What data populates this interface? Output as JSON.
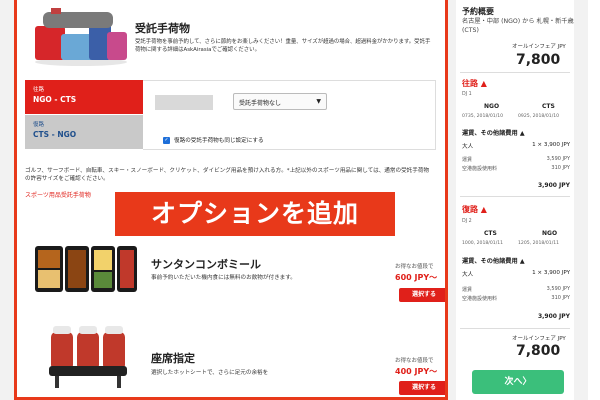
{
  "baggage": {
    "title": "受託手荷物",
    "desc": "受託手荷物を事前予約して、さらに節約をお楽しみください！重量、サイズが超過の場合、超過料金がかかります。受託手荷物に関する詳細はAskAirasiaでご確認ください。",
    "leg1_label": "往路",
    "leg1_route": "NGO - CTS",
    "leg2_label": "復路",
    "leg2_route": "CTS - NGO",
    "select_value": "受託手荷物なし",
    "same_return_label": "復路の受託手荷物も同じ設定にする"
  },
  "sports": {
    "desc": "ゴルフ、サーフボード、自転車、スキー・スノーボード、クリケット、ダイビング用品を預け入れる方。*上記以外のスポーツ用品に関しては、通常の受託手荷物の許容サイズをご確認ください。",
    "link": "スポーツ用品受託手荷物"
  },
  "banner": "オプションを追加",
  "meal": {
    "title": "サンタンコンボミール",
    "desc": "事前予約いただいた機内食には無料のお飲物が付きます。",
    "price_label": "お得なお値段で",
    "price": "600 JPY〜",
    "button": "選択する"
  },
  "seat": {
    "title": "座席指定",
    "desc": "選択したホットシートで、さらに足元の余裕を",
    "price_label": "お得なお値段で",
    "price": "400 JPY〜",
    "button": "選択する"
  },
  "summary": {
    "title": "予約概要",
    "route": "名古屋・中部 (NGO) から 札幌・新千歳 (CTS)",
    "fare_label": "オールインフェア JPY",
    "total": "7,800",
    "outbound": {
      "head": "往路",
      "flight": "DJ 1",
      "from": "NGO",
      "to": "CTS",
      "dep": "0735, 2018/01/10",
      "arr": "0925, 2018/01/10",
      "fare_head": "運賃、その他諸費用",
      "pax_label": "大人",
      "pax_value": "1 × 3,900 JPY",
      "fare_label": "運賃",
      "fare_value": "3,590 JPY",
      "fee_label": "空港施設使用料",
      "fee_value": "310 JPY",
      "subtotal": "3,900 JPY"
    },
    "inbound": {
      "head": "復路",
      "flight": "DJ 2",
      "from": "CTS",
      "to": "NGO",
      "dep": "1000, 2018/01/11",
      "arr": "1205, 2018/01/11",
      "fare_head": "運賃、その他諸費用",
      "pax_label": "大人",
      "pax_value": "1 × 3,900 JPY",
      "fare_label": "運賃",
      "fare_value": "3,590 JPY",
      "fee_label": "空港施設使用料",
      "fee_value": "310 JPY",
      "subtotal": "3,900 JPY"
    },
    "next_button": "次へ〉"
  },
  "colors": {
    "accent": "#e0201a",
    "frame": "#e8391a",
    "next": "#3bbf7b",
    "return_text": "#1f4f8c"
  }
}
